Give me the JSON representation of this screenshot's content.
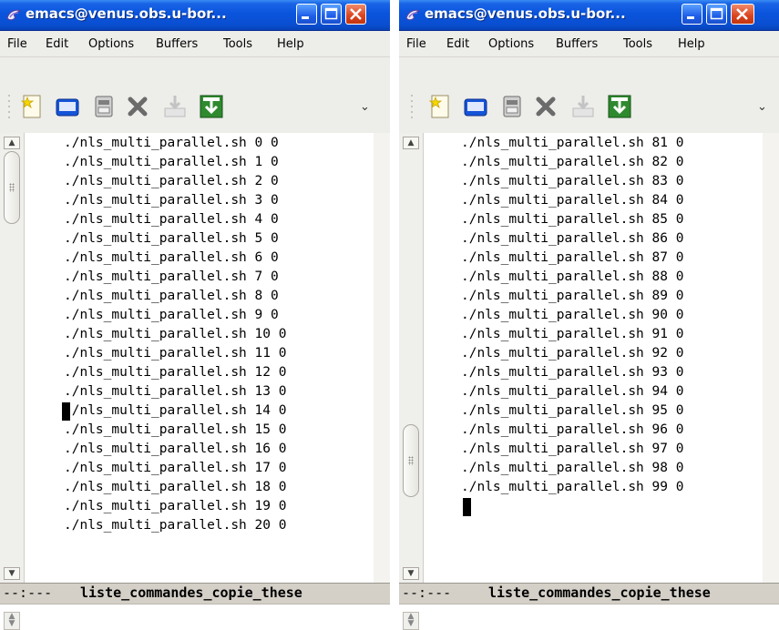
{
  "windows": {
    "left": {
      "title": "emacs@venus.obs.u-bor...",
      "menu": [
        "File",
        "Edit",
        "Options",
        "Buffers",
        "Tools",
        "Help"
      ],
      "lines": [
        "./nls_multi_parallel.sh 0 0",
        "./nls_multi_parallel.sh 1 0",
        "./nls_multi_parallel.sh 2 0",
        "./nls_multi_parallel.sh 3 0",
        "./nls_multi_parallel.sh 4 0",
        "./nls_multi_parallel.sh 5 0",
        "./nls_multi_parallel.sh 6 0",
        "./nls_multi_parallel.sh 7 0",
        "./nls_multi_parallel.sh 8 0",
        "./nls_multi_parallel.sh 9 0",
        "./nls_multi_parallel.sh 10 0",
        "./nls_multi_parallel.sh 11 0",
        "./nls_multi_parallel.sh 12 0",
        "./nls_multi_parallel.sh 13 0",
        "./nls_multi_parallel.sh 14 0",
        "./nls_multi_parallel.sh 15 0",
        "./nls_multi_parallel.sh 16 0",
        "./nls_multi_parallel.sh 17 0",
        "./nls_multi_parallel.sh 18 0",
        "./nls_multi_parallel.sh 19 0",
        "./nls_multi_parallel.sh 20 0"
      ],
      "cursor_line": 15,
      "mode_status": "--:---",
      "buffer_name": "liste_commandes_copie_these"
    },
    "right": {
      "title": "emacs@venus.obs.u-bor...",
      "menu": [
        "File",
        "Edit",
        "Options",
        "Buffers",
        "Tools",
        "Help"
      ],
      "lines": [
        "./nls_multi_parallel.sh 81 0",
        "./nls_multi_parallel.sh 82 0",
        "./nls_multi_parallel.sh 83 0",
        "./nls_multi_parallel.sh 84 0",
        "./nls_multi_parallel.sh 85 0",
        "./nls_multi_parallel.sh 86 0",
        "./nls_multi_parallel.sh 87 0",
        "./nls_multi_parallel.sh 88 0",
        "./nls_multi_parallel.sh 89 0",
        "./nls_multi_parallel.sh 90 0",
        "./nls_multi_parallel.sh 91 0",
        "./nls_multi_parallel.sh 92 0",
        "./nls_multi_parallel.sh 93 0",
        "./nls_multi_parallel.sh 94 0",
        "./nls_multi_parallel.sh 95 0",
        "./nls_multi_parallel.sh 96 0",
        "./nls_multi_parallel.sh 97 0",
        "./nls_multi_parallel.sh 98 0",
        "./nls_multi_parallel.sh 99 0"
      ],
      "cursor_line": 20,
      "mode_status": "--:---",
      "buffer_name": "liste_commandes_copie_these"
    }
  },
  "toolbar": {
    "icons": [
      "new-file-icon",
      "open-folder-icon",
      "save-icon",
      "close-x-icon",
      "save-download-icon",
      "save-as-icon"
    ],
    "overflow_icon": "chevron-down-icon"
  },
  "scroll_position": {
    "left": 0.0,
    "right": 1.0
  },
  "colors": {
    "titlebar_blue": "#0a54dc",
    "close_red": "#d9431f",
    "modeline_gray": "#d4d0c8"
  }
}
